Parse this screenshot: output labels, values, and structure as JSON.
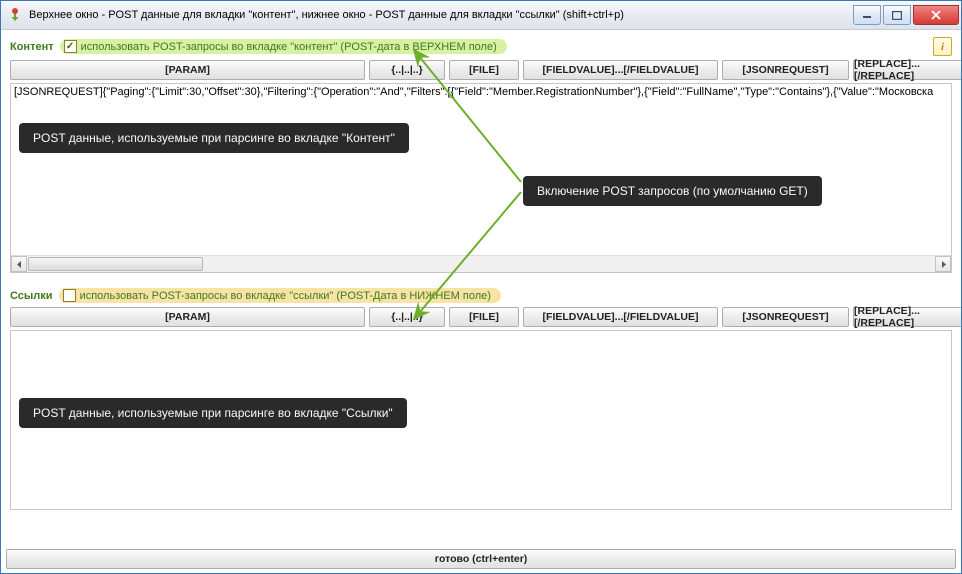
{
  "window": {
    "title": "Верхнее окно - POST данные для вкладки \"контент\", нижнее окно - POST данные для вкладки \"ссылки\" (shift+ctrl+p)"
  },
  "info_btn": "i",
  "top": {
    "title": "Контент",
    "checkbox_label": "использовать POST-запросы во вкладке \"контент\" (POST-дата в ВЕРХНЕМ поле)",
    "checked": true,
    "editor_text": "[JSONREQUEST]{\"Paging\":{\"Limit\":30,\"Offset\":30},\"Filtering\":{\"Operation\":\"And\",\"Filters\":[{\"Field\":\"Member.RegistrationNumber\"},{\"Field\":\"FullName\",\"Type\":\"Contains\"},{\"Value\":\"Московска"
  },
  "bottom": {
    "title": "Ссылки",
    "checkbox_label": "использовать POST-запросы во вкладке \"ссылки\" (POST-Дата в НИЖНЕМ поле)",
    "checked": false,
    "editor_text": ""
  },
  "toolbar": {
    "param": "[PARAM]",
    "brace": "{..|..|..}",
    "file": "[FILE]",
    "field": "[FIELDVALUE]...[/FIELDVALUE]",
    "json": "[JSONREQUEST]",
    "replace": "[REPLACE]...[/REPLACE]"
  },
  "callouts": {
    "top_desc": "POST данные, используемые при парсинге во вкладке \"Контент\"",
    "enable_post": "Включение POST запросов (по умолчанию GET)",
    "bottom_desc": "POST данные, используемые при парсинге во вкладке \"Ссылки\""
  },
  "footer": {
    "label": "готово (ctrl+enter)"
  }
}
